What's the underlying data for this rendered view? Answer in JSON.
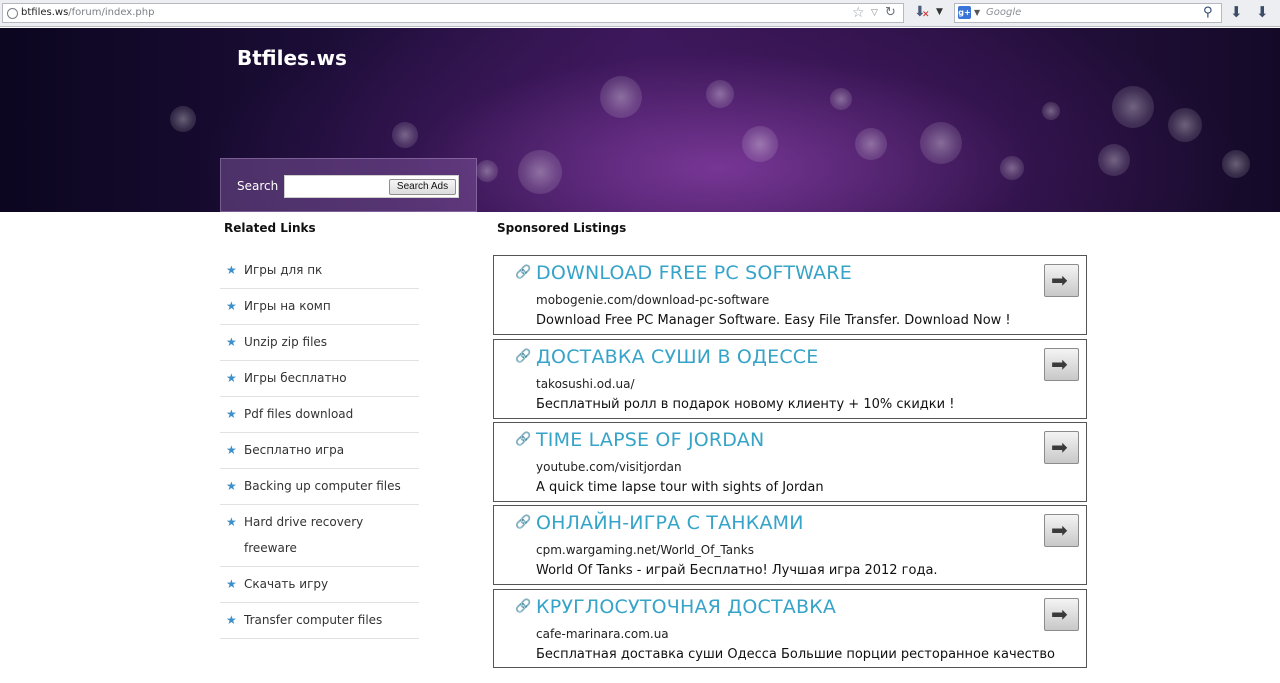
{
  "browser": {
    "url_host": "btfiles.ws",
    "url_path": "/forum/index.php",
    "search_placeholder": "Google",
    "search_engine_badge": "g+",
    "icons": [
      "favicon-icon",
      "bookmark-star-icon",
      "dropdown-arrow-icon",
      "reload-icon",
      "download-addon-icon",
      "google-icon",
      "search-magnifier-icon",
      "downloads-arrow-icon",
      "menu-arrow-icon"
    ]
  },
  "header": {
    "site_title": "Btfiles.ws",
    "search_label": "Search",
    "search_value": "",
    "search_button": "Search Ads"
  },
  "left": {
    "title": "Related Links",
    "links": [
      "Игры для пк",
      "Игры на комп",
      "Unzip zip files",
      "Игры бесплатно",
      "Pdf files download",
      "Бесплатно игра",
      "Backing up computer files",
      "Hard drive recovery freeware",
      "Скачать игру",
      "Transfer computer files"
    ]
  },
  "right": {
    "title": "Sponsored Listings",
    "ads": [
      {
        "title": "DOWNLOAD FREE PC SOFTWARE",
        "url": "mobogenie.com/download-pc-software",
        "desc": "Download Free PC Manager Software. Easy File Transfer. Download Now !"
      },
      {
        "title": "ДОСТАВКА СУШИ В ОДЕССЕ",
        "url": "takosushi.od.ua/",
        "desc": "Бесплатный ролл в подарок новому клиенту + 10% скидки !"
      },
      {
        "title": "TIME LAPSE OF JORDAN",
        "url": "youtube.com/visitjordan",
        "desc": "A quick time lapse tour with sights of Jordan"
      },
      {
        "title": "ОНЛАЙН-ИГРА С ТАНКАМИ",
        "url": "cpm.wargaming.net/World_Of_Tanks",
        "desc": "World Of Tanks - играй Бесплатно! Лучшая игра 2012 года."
      },
      {
        "title": "КРУГЛОСУТОЧНАЯ ДОСТАВКА",
        "url": "cafe-marinara.com.ua",
        "desc": "Бесплатная доставка суши Одесса Большие порции ресторанное качество"
      }
    ]
  },
  "colors": {
    "ad_title": "#36a3c8",
    "star": "#3d8fc9",
    "banner_dark": "#140a28",
    "banner_purple": "#3a1858"
  }
}
